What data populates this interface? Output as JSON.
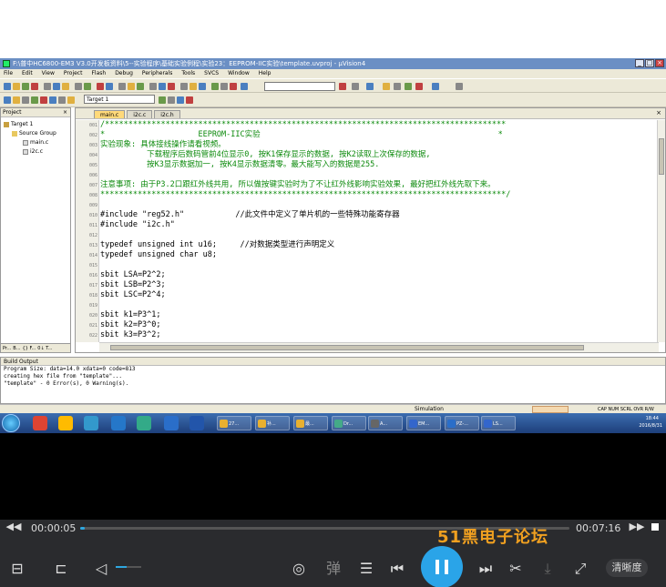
{
  "window": {
    "title": "F:\\普中HC6800-EM3 V3.0开发板资料\\5--实验程序\\基础实验例程\\实验23：EEPROM-IIC实验\\template.uvproj - µVision4"
  },
  "menu": [
    "File",
    "Edit",
    "View",
    "Project",
    "Flash",
    "Debug",
    "Peripherals",
    "Tools",
    "SVCS",
    "Window",
    "Help"
  ],
  "toolbar": {
    "target": "Target 1"
  },
  "project_panel": {
    "title": "Project",
    "tree": [
      {
        "label": "Target 1",
        "level": 0
      },
      {
        "label": "Source Group",
        "level": 1
      },
      {
        "label": "main.c",
        "level": 2
      },
      {
        "label": "i2c.c",
        "level": 2
      }
    ],
    "tabs": [
      "Pr...",
      "B...",
      "{} F...",
      "0↓ T..."
    ]
  },
  "editor": {
    "tabs": [
      {
        "label": "main.c",
        "active": true
      },
      {
        "label": "i2c.c",
        "active": false
      },
      {
        "label": "i2c.h",
        "active": false
      }
    ],
    "line_numbers": [
      "001",
      "002",
      "003",
      "004",
      "005",
      "006",
      "007",
      "008",
      "009",
      "010",
      "011",
      "012",
      "013",
      "014",
      "015",
      "016",
      "017",
      "018",
      "019",
      "020",
      "021",
      "022"
    ],
    "lines": [
      "/**************************************************************************************",
      "*                    EEPROM-IIC实验                                                   *",
      "实验现象: 具体接线操作请看视频。",
      "          下载程序后数码管前4位显示0, 按K1保存显示的数据, 按K2读取上次保存的数据,",
      "          按K3显示数据加一, 按K4显示数据清零。最大能写入的数据是255.",
      "",
      "注意事项: 由于P3.2口跟红外线共用, 所以做按键实验时为了不让红外线影响实验效果, 最好把红外线先取下来。",
      "***************************************************************************************/",
      "",
      "#include \"reg52.h\"           //此文件中定义了单片机的一些特殊功能寄存器",
      "#include \"i2c.h\"",
      "",
      "typedef unsigned int u16;     //对数据类型进行声明定义",
      "typedef unsigned char u8;",
      "",
      "sbit LSA=P2^2;",
      "sbit LSB=P2^3;",
      "sbit LSC=P2^4;",
      "",
      "sbit k1=P3^1;",
      "sbit k2=P3^0;",
      "sbit k3=P3^2;"
    ]
  },
  "build_output": {
    "title": "Build Output",
    "lines": [
      "Program Size: data=14.0 xdata=0 code=813",
      "creating hex file from \"template\"...",
      "\"template\" - 0 Error(s), 0 Warning(s)."
    ]
  },
  "status": {
    "simulation": "Simulation",
    "right": "CAP  NUM  SCRL  OVR  R/W"
  },
  "taskbar": {
    "items": [
      "27...",
      "补...",
      "最...",
      "Dr...",
      "A...",
      "EM...",
      "PZ-...",
      "LS..."
    ],
    "clock_time": "18:44",
    "clock_date": "2016/8/31"
  },
  "player": {
    "current_time": "00:00:05",
    "total_time": "00:07:16",
    "progress": 0.01,
    "watermark": "51黑电子论坛",
    "danmaku_label": "弹",
    "quality_label": "清晰度"
  },
  "colors": {
    "accent": "#2aa4e8",
    "comment_green": "#0c8a0c",
    "titlebar": "#6b8fc4"
  }
}
